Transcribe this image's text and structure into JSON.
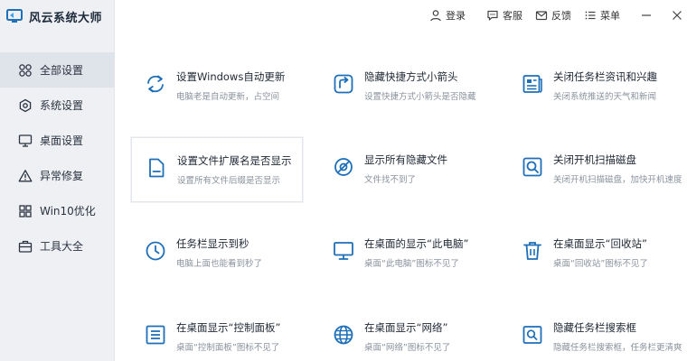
{
  "app": {
    "title": "风云系统大师"
  },
  "topbar": {
    "login": "登录",
    "service": "客服",
    "feedback": "反馈",
    "menu": "菜单"
  },
  "sidebar": {
    "items": [
      {
        "label": "全部设置",
        "icon": "grid-circles-icon",
        "active": true
      },
      {
        "label": "系统设置",
        "icon": "settings-hex-icon",
        "active": false
      },
      {
        "label": "桌面设置",
        "icon": "monitor-icon",
        "active": false
      },
      {
        "label": "异常修复",
        "icon": "warning-icon",
        "active": false
      },
      {
        "label": "Win10优化",
        "icon": "windows-icon",
        "active": false
      },
      {
        "label": "工具大全",
        "icon": "toolbox-icon",
        "active": false
      }
    ]
  },
  "cards": [
    {
      "title": "设置Windows自动更新",
      "desc": "电脑老是自动更新，占空间",
      "icon": "refresh-icon"
    },
    {
      "title": "隐藏快捷方式小箭头",
      "desc": "设置快捷方式小箭头是否隐藏",
      "icon": "shortcut-arrow-icon"
    },
    {
      "title": "关闭任务栏资讯和兴趣",
      "desc": "关闭系统推送的天气和新闻",
      "icon": "news-icon"
    },
    {
      "title": "设置文件扩展名是否显示",
      "desc": "设置所有文件后缀是否显示",
      "icon": "file-icon"
    },
    {
      "title": "显示所有隐藏文件",
      "desc": "文件找不到了",
      "icon": "hidden-eye-icon"
    },
    {
      "title": "关闭开机扫描磁盘",
      "desc": "关闭开机扫描磁盘，加快开机速度",
      "icon": "disk-scan-icon"
    },
    {
      "title": "任务栏显示到秒",
      "desc": "电脑上面也能看到秒了",
      "icon": "clock-icon"
    },
    {
      "title": "在桌面的显示“此电脑”",
      "desc": "桌面“此电脑”图标不见了",
      "icon": "computer-icon"
    },
    {
      "title": "在桌面显示“回收站”",
      "desc": "桌面“回收站”图标不见了",
      "icon": "trash-icon"
    },
    {
      "title": "在桌面显示“控制面板”",
      "desc": "桌面“控制面板”图标不见了",
      "icon": "control-panel-icon"
    },
    {
      "title": "在桌面显示“网络”",
      "desc": "桌面“网络”图标不见了",
      "icon": "globe-icon"
    },
    {
      "title": "隐藏任务栏搜索框",
      "desc": "隐藏任务栏搜索框，任务栏更清爽",
      "icon": "search-box-icon"
    }
  ],
  "colors": {
    "accent": "#1f6fb8",
    "sidebar_bg": "#eef0f4",
    "sidebar_active": "#dfe3ea"
  }
}
